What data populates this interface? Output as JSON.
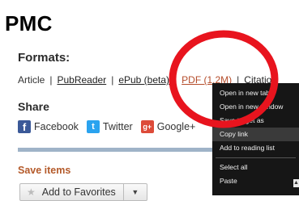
{
  "page": {
    "heading": "PMC"
  },
  "formats": {
    "title": "Formats:",
    "items": [
      "Article",
      "PubReader",
      "ePub (beta)",
      "PDF (1.2M)",
      "Citation"
    ],
    "separator": "|"
  },
  "share": {
    "title": "Share",
    "items": [
      {
        "label": "Facebook",
        "icon": "facebook-icon",
        "glyph": "f",
        "color": "#3b5998"
      },
      {
        "label": "Twitter",
        "icon": "twitter-icon",
        "glyph": "t",
        "color": "#2aa3ef"
      },
      {
        "label": "Google+",
        "icon": "google-plus-icon",
        "glyph": "g+",
        "color": "#dd4b39"
      }
    ]
  },
  "save_items": {
    "title": "Save items",
    "button_label": "Add to Favorites",
    "star_icon": "star-icon",
    "dropdown_icon": "caret-down-icon"
  },
  "context_menu": {
    "items": [
      "Open in new tab",
      "Open in new window",
      "Save target as",
      "Copy link",
      "Add to reading list",
      "Select all",
      "Paste"
    ],
    "highlighted_index": 3
  },
  "annotation": {
    "color": "#e8141e"
  }
}
